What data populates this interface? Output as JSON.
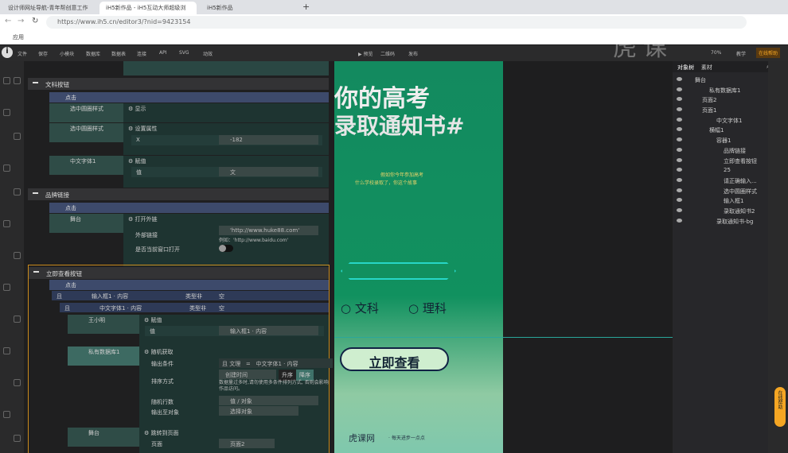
{
  "browser": {
    "tabs": [
      "设计师网址导航-青年帮创意工作",
      "iH5新作品 - iH5互动大师超级浏",
      "iH5新作品"
    ],
    "url": "https://www.ih5.cn/editor3/?nid=9423154",
    "bookmark": "应用"
  },
  "toolbar": {
    "left": [
      "文件",
      "保存",
      "小模块",
      "数据库",
      "数据表",
      "连接",
      "API",
      "SVG",
      "动效"
    ],
    "center": [
      "预览",
      "二维码",
      "发布"
    ],
    "zoom": "70%",
    "teach": "教学",
    "help": "在线帮助",
    "watermark": "虎课"
  },
  "logic": {
    "s1": {
      "title": "文科按钮",
      "event": "点击",
      "r1": {
        "obj": "选中圆圈样式",
        "act": "显示"
      },
      "r2": {
        "obj": "选中圆圈样式",
        "act": "设置属性",
        "prop": "X",
        "val": "-182"
      },
      "r3": {
        "obj": "中文字体1",
        "act": "赋值",
        "prop": "值",
        "val": "文"
      }
    },
    "s2": {
      "title": "品牌链接",
      "event": "点击",
      "obj": "舞台",
      "act": "打开外链",
      "link_label": "外部链接",
      "link": "'http://www.huke88.com'",
      "example": "例如：'http://www.baidu.com'",
      "window_label": "是否当前窗口打开"
    },
    "s3": {
      "title": "立即查看按钮",
      "event": "点击",
      "c1": {
        "op": "且",
        "left": "输入框1 · 内容",
        "cmp": "类型非",
        "right": "空"
      },
      "c2": {
        "op": "且",
        "left": "中文字体1 · 内容",
        "cmp": "类型非",
        "right": "空"
      },
      "a1": {
        "obj": "王小明",
        "act": "赋值",
        "prop": "值",
        "val": "输入框1 · 内容"
      },
      "a2": {
        "obj": "私有数据库1",
        "act": "随机获取",
        "cond_label": "输出条件",
        "cond_op": "且",
        "cond_field": "文理",
        "cond_eq": "=",
        "cond_val": "中文字体1 · 内容",
        "sort_label": "排序方式",
        "sort_field": "创建时间",
        "asc": "升序",
        "desc": "降序",
        "sort_note": "数据量过多时,请勿使用多条件排列方式, 否则会影响作品访问。",
        "rows_label": "随机行数",
        "rows_val": "值 / 对象",
        "out_label": "输出至对象",
        "out_val": "选择对象"
      },
      "a3": {
        "obj": "舞台",
        "act": "跳转到页面",
        "prop": "页面",
        "val": "页面2"
      }
    }
  },
  "canvas": {
    "title1": "你的高考",
    "title2": "录取通知书#",
    "sub1": "假如你今年参加高考",
    "sub2": "什么学校录取了，你这个故事",
    "opt1": "文科",
    "opt2": "理科",
    "button": "立即查看",
    "brand": "虎课网",
    "slogan": "· 每天进步一点点"
  },
  "panel": {
    "tabs": [
      "对象树",
      "素材"
    ],
    "items": [
      {
        "label": "舞台",
        "indent": 0
      },
      {
        "label": "私有数据库1",
        "indent": 2
      },
      {
        "label": "页面2",
        "indent": 1
      },
      {
        "label": "页面1",
        "indent": 1
      },
      {
        "label": "中文字体1",
        "indent": 3
      },
      {
        "label": "横幅1",
        "indent": 2
      },
      {
        "label": "容器1",
        "indent": 3
      },
      {
        "label": "品牌链接",
        "indent": 4
      },
      {
        "label": "立即查看按钮",
        "indent": 4
      },
      {
        "label": "25",
        "indent": 4
      },
      {
        "label": "请正确输入...",
        "indent": 4
      },
      {
        "label": "选中圆圈样式",
        "indent": 4
      },
      {
        "label": "输入框1",
        "indent": 4
      },
      {
        "label": "录取通知书2",
        "indent": 4
      },
      {
        "label": "录取通知书-bg",
        "indent": 3
      }
    ]
  },
  "side_help": "在线帮助"
}
